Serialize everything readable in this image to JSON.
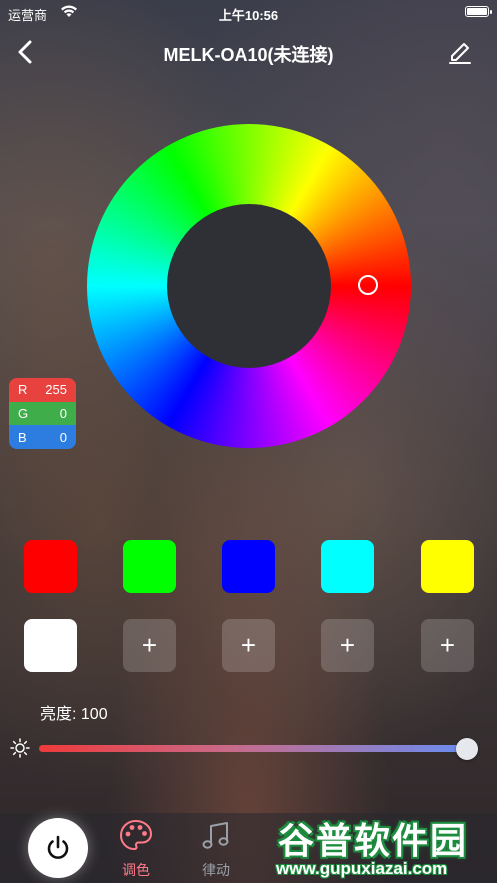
{
  "status_bar": {
    "carrier": "运营商",
    "time": "上午10:56"
  },
  "nav": {
    "title": "MELK-OA10(未连接)"
  },
  "rgb": {
    "r_label": "R",
    "r_value": "255",
    "g_label": "G",
    "g_value": "0",
    "b_label": "B",
    "b_value": "0"
  },
  "presets": {
    "colors": [
      "#ff0000",
      "#00ff00",
      "#0000ff",
      "#00ffff",
      "#ffff00",
      "#ffffff"
    ],
    "add_label": "+"
  },
  "brightness": {
    "label": "亮度: 100",
    "value": 100
  },
  "tabs": [
    {
      "label": "调色",
      "active": true
    },
    {
      "label": "律动",
      "active": false
    }
  ],
  "watermark": {
    "title": "谷普软件园",
    "url": "www.gupuxiazai.com"
  },
  "colors": {
    "active_tab": "#ff7b8a",
    "slider_start": "#ee3b3b",
    "slider_end": "#6a8cf0"
  }
}
